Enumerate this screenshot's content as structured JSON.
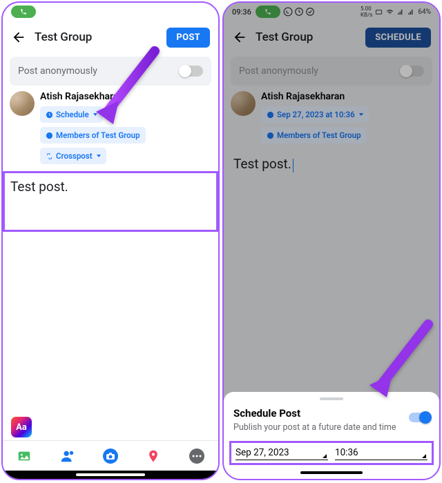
{
  "left": {
    "header": {
      "title": "Test Group",
      "button": "POST"
    },
    "anon": {
      "label": "Post anonymously"
    },
    "user": {
      "name": "Atish Rajasekharan"
    },
    "chips": {
      "schedule": "Schedule",
      "members": "Members of Test Group",
      "crosspost": "Crosspost"
    },
    "post_text": "Test post.",
    "aa_label": "Aa"
  },
  "right": {
    "status": {
      "time": "09:36",
      "battery": "64%"
    },
    "header": {
      "title": "Test Group",
      "button": "SCHEDULE"
    },
    "anon": {
      "label": "Post anonymously"
    },
    "user": {
      "name": "Atish Rajasekharan"
    },
    "chips": {
      "scheduled": "Sep 27, 2023 at 10:36",
      "members": "Members of Test Group"
    },
    "post_text": "Test post.",
    "sheet": {
      "title": "Schedule Post",
      "subtitle": "Publish your post at a future date and time",
      "date": "Sep 27, 2023",
      "time": "10:36"
    }
  }
}
